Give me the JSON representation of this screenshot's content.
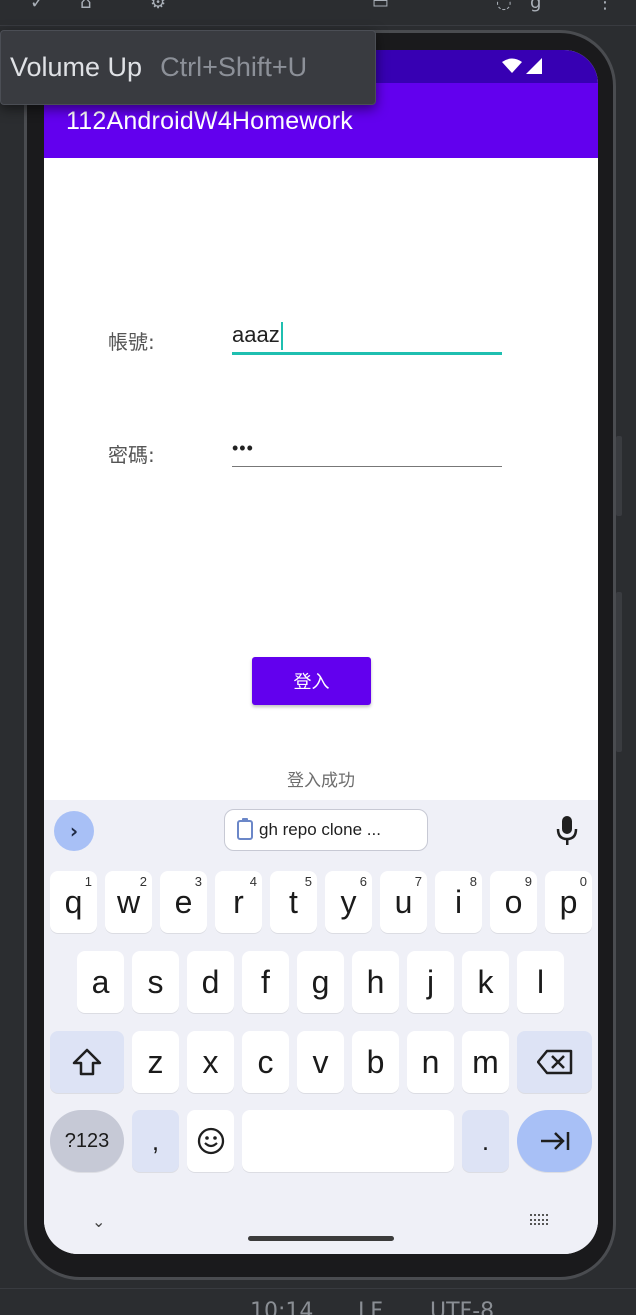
{
  "app": {
    "title": "112AndroidW4Homework"
  },
  "tooltip": {
    "label": "Volume Up",
    "shortcut": "Ctrl+Shift+U"
  },
  "form": {
    "account_label": "帳號:",
    "account_value": "aaaz",
    "password_label": "密碼:",
    "password_value": "•••",
    "login_button": "登入",
    "result_text": "登入成功"
  },
  "keyboard": {
    "clipboard_chip": "gh repo clone ...",
    "row1": [
      {
        "key": "q",
        "hint": "1"
      },
      {
        "key": "w",
        "hint": "2"
      },
      {
        "key": "e",
        "hint": "3"
      },
      {
        "key": "r",
        "hint": "4"
      },
      {
        "key": "t",
        "hint": "5"
      },
      {
        "key": "y",
        "hint": "6"
      },
      {
        "key": "u",
        "hint": "7"
      },
      {
        "key": "i",
        "hint": "8"
      },
      {
        "key": "o",
        "hint": "9"
      },
      {
        "key": "p",
        "hint": "0"
      }
    ],
    "row2": [
      "a",
      "s",
      "d",
      "f",
      "g",
      "h",
      "j",
      "k",
      "l"
    ],
    "row3": [
      "z",
      "x",
      "c",
      "v",
      "b",
      "n",
      "m"
    ],
    "symbols_key": "?123",
    "comma_key": ",",
    "period_key": "."
  },
  "ide_status": {
    "time": "10:14",
    "line_sep": "LF",
    "encoding": "UTF-8"
  },
  "colors": {
    "primary": "#6200ee",
    "primary_dark": "#3700b3",
    "focus_underline": "#1fbfb0"
  }
}
